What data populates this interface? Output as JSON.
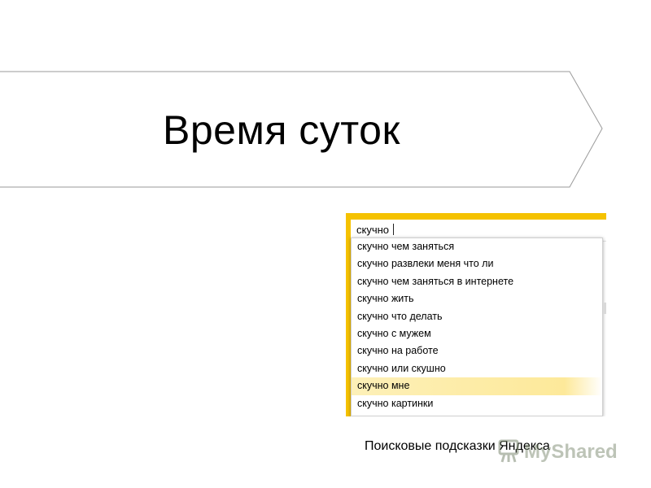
{
  "slide": {
    "title": "Время суток",
    "caption": "Поисковые подсказки Яндекса"
  },
  "search": {
    "query": "скучно",
    "suggestions": [
      "скучно чем заняться",
      "скучно развлеки меня что ли",
      "скучно чем заняться в интернете",
      "скучно жить",
      "скучно что делать",
      "скучно с мужем",
      "скучно на работе",
      "скучно или скушно",
      "скучно мне",
      "скучно картинки"
    ],
    "highlighted_index": 8
  },
  "watermark": {
    "text": "MyShared",
    "icon": "presentation-board-icon"
  },
  "colors": {
    "search_accent": "#f5c200",
    "highlight": "#fde99a",
    "banner_outline": "#9a9a9a"
  }
}
